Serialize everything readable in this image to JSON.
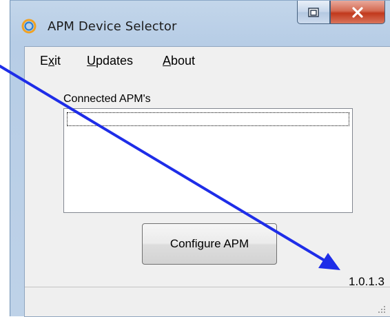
{
  "window": {
    "title": "APM Device Selector",
    "icon": "apm-ring-icon",
    "caption_buttons": [
      "restore",
      "close"
    ]
  },
  "menu": {
    "items": [
      {
        "label_pre": "E",
        "label_ul": "x",
        "label_post": "it"
      },
      {
        "label_pre": "",
        "label_ul": "U",
        "label_post": "pdates"
      },
      {
        "label_pre": "",
        "label_ul": "A",
        "label_post": "bout"
      }
    ]
  },
  "connected": {
    "label": "Connected APM's",
    "items": []
  },
  "configure_button": "Configure APM",
  "version": "1.0.1.3",
  "annotation": {
    "color": "#1e2de8"
  }
}
